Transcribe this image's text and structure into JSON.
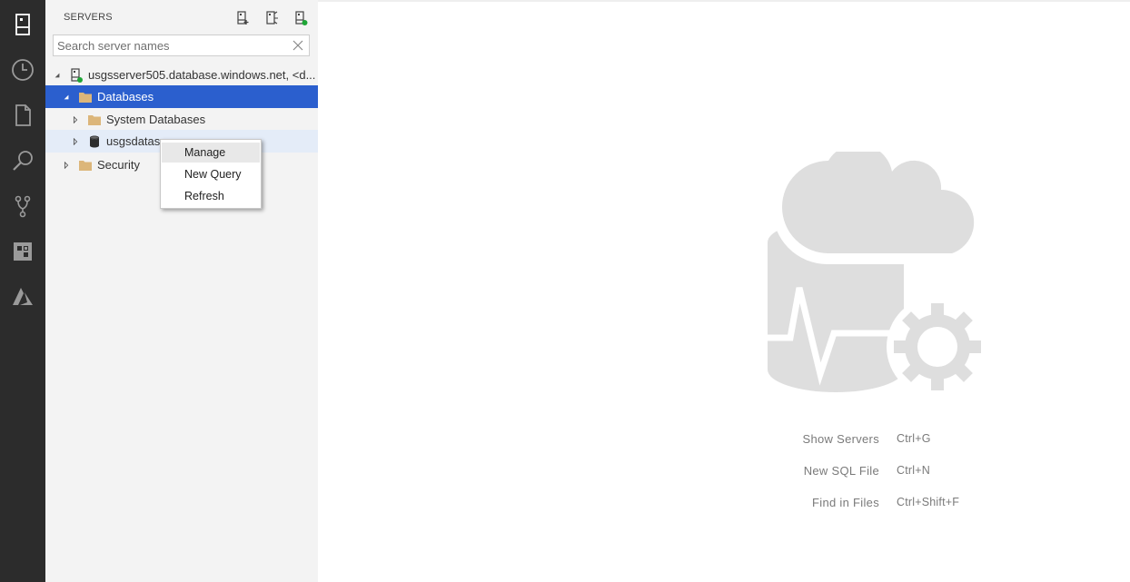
{
  "activity_bar": {
    "items": [
      {
        "icon": "servers-icon"
      },
      {
        "icon": "task-history-icon"
      },
      {
        "icon": "explorer-file-icon"
      },
      {
        "icon": "search-icon"
      },
      {
        "icon": "source-control-icon"
      },
      {
        "icon": "extensions-icon"
      },
      {
        "icon": "azure-icon"
      }
    ]
  },
  "sidebar": {
    "title": "SERVERS",
    "actions": [
      "new-connection-icon",
      "new-server-group-icon",
      "active-connections-icon"
    ],
    "search": {
      "placeholder": "Search server names",
      "value": ""
    },
    "tree": {
      "server": "usgsserver505.database.windows.net, <d...",
      "databases": "Databases",
      "system_databases": "System Databases",
      "user_database": "usgsdatas",
      "security": "Security"
    },
    "status_color": "#1ea536",
    "selection_color": "#2b5fce"
  },
  "context_menu": {
    "items": [
      "Manage",
      "New Query",
      "Refresh"
    ]
  },
  "editor": {
    "shortcuts": [
      {
        "label": "Show Servers",
        "key": "Ctrl+G"
      },
      {
        "label": "New SQL File",
        "key": "Ctrl+N"
      },
      {
        "label": "Find in Files",
        "key": "Ctrl+Shift+F"
      }
    ]
  }
}
